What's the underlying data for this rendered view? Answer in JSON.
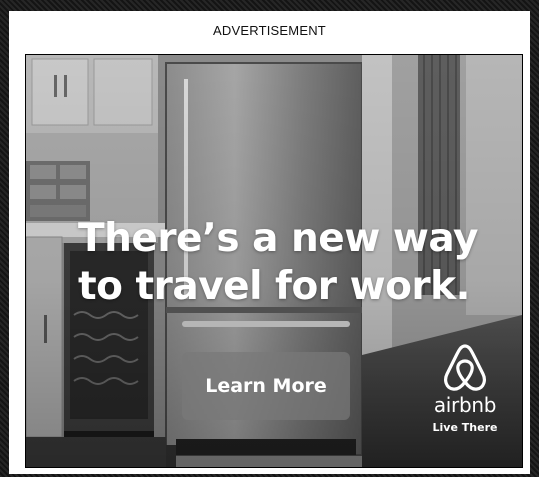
{
  "ad": {
    "label": "ADVERTISEMENT",
    "headline_line1": "There’s a new way",
    "headline_line2": "to travel for work.",
    "cta_label": "Learn More",
    "brand_name": "airbnb",
    "brand_tagline": "Live There",
    "brand_logo_icon": "airbnb-belo-icon",
    "colors": {
      "text": "#ffffff",
      "button_bg": "#787878",
      "panel_bg": "#ffffff"
    }
  }
}
